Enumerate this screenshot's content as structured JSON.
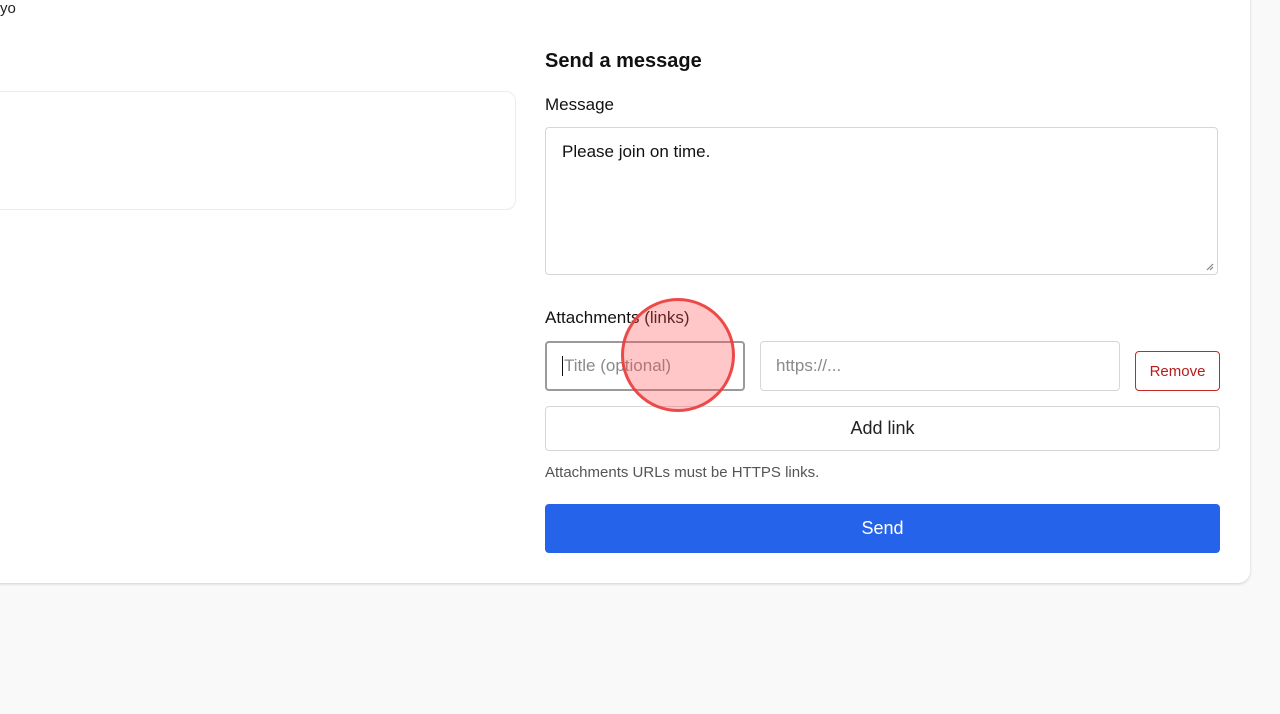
{
  "top_text": "yo",
  "form": {
    "title": "Send a message",
    "message_label": "Message",
    "message_value": "Please join on time.",
    "attachments_label": "Attachments (links)",
    "title_placeholder": "Title (optional)",
    "url_placeholder": "https://...",
    "remove_label": "Remove",
    "add_link_label": "Add link",
    "hint": "Attachments URLs must be HTTPS links.",
    "send_label": "Send"
  },
  "colors": {
    "primary": "#2563eb",
    "danger": "#c62828"
  }
}
